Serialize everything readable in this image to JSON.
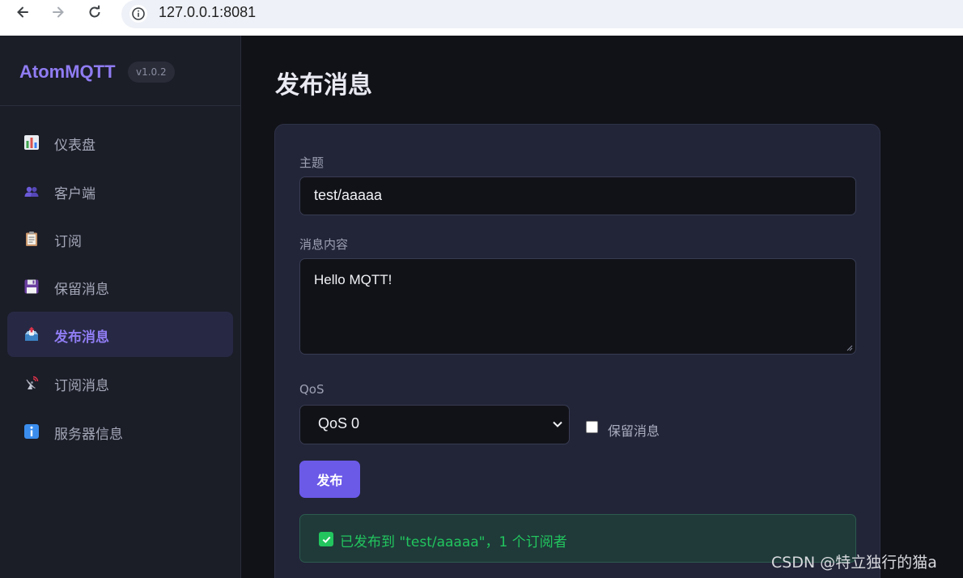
{
  "browser": {
    "url": "127.0.0.1:8081",
    "icons": {
      "back": "arrow-left-icon",
      "forward": "arrow-right-icon",
      "reload": "reload-icon",
      "info": "info-icon"
    }
  },
  "sidebar": {
    "brand": "AtomMQTT",
    "version": "v1.0.2",
    "items": [
      {
        "label": "仪表盘",
        "icon": "bar-chart-icon"
      },
      {
        "label": "客户端",
        "icon": "users-icon"
      },
      {
        "label": "订阅",
        "icon": "clipboard-icon"
      },
      {
        "label": "保留消息",
        "icon": "floppy-disk-icon"
      },
      {
        "label": "发布消息",
        "icon": "outbox-tray-icon",
        "active": true
      },
      {
        "label": "订阅消息",
        "icon": "satellite-antenna-icon"
      },
      {
        "label": "服务器信息",
        "icon": "information-icon"
      }
    ]
  },
  "main": {
    "title": "发布消息",
    "form": {
      "topic_label": "主题",
      "topic_value": "test/aaaaa",
      "content_label": "消息内容",
      "content_value": "Hello MQTT!",
      "qos_label": "QoS",
      "qos_value": "QoS 0",
      "retain_label": "保留消息",
      "retain_checked": false,
      "publish_label": "发布"
    },
    "alert": {
      "message": "已发布到 \"test/aaaaa\"，1 个订阅者",
      "status": "success"
    }
  },
  "watermark": "CSDN @特立独行的猫a",
  "colors": {
    "accent": "#6b5ae8",
    "brand": "#8f7cf2",
    "success": "#22c55e",
    "background": "#111218",
    "sidebar": "#1b1d27",
    "card": "#222538"
  }
}
